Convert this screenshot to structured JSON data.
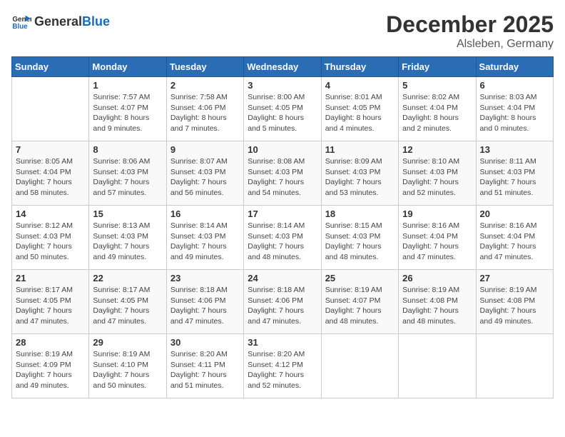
{
  "header": {
    "logo_general": "General",
    "logo_blue": "Blue",
    "month_year": "December 2025",
    "location": "Alsleben, Germany"
  },
  "weekdays": [
    "Sunday",
    "Monday",
    "Tuesday",
    "Wednesday",
    "Thursday",
    "Friday",
    "Saturday"
  ],
  "weeks": [
    [
      {
        "day": "",
        "info": ""
      },
      {
        "day": "1",
        "info": "Sunrise: 7:57 AM\nSunset: 4:07 PM\nDaylight: 8 hours\nand 9 minutes."
      },
      {
        "day": "2",
        "info": "Sunrise: 7:58 AM\nSunset: 4:06 PM\nDaylight: 8 hours\nand 7 minutes."
      },
      {
        "day": "3",
        "info": "Sunrise: 8:00 AM\nSunset: 4:05 PM\nDaylight: 8 hours\nand 5 minutes."
      },
      {
        "day": "4",
        "info": "Sunrise: 8:01 AM\nSunset: 4:05 PM\nDaylight: 8 hours\nand 4 minutes."
      },
      {
        "day": "5",
        "info": "Sunrise: 8:02 AM\nSunset: 4:04 PM\nDaylight: 8 hours\nand 2 minutes."
      },
      {
        "day": "6",
        "info": "Sunrise: 8:03 AM\nSunset: 4:04 PM\nDaylight: 8 hours\nand 0 minutes."
      }
    ],
    [
      {
        "day": "7",
        "info": "Sunrise: 8:05 AM\nSunset: 4:04 PM\nDaylight: 7 hours\nand 58 minutes."
      },
      {
        "day": "8",
        "info": "Sunrise: 8:06 AM\nSunset: 4:03 PM\nDaylight: 7 hours\nand 57 minutes."
      },
      {
        "day": "9",
        "info": "Sunrise: 8:07 AM\nSunset: 4:03 PM\nDaylight: 7 hours\nand 56 minutes."
      },
      {
        "day": "10",
        "info": "Sunrise: 8:08 AM\nSunset: 4:03 PM\nDaylight: 7 hours\nand 54 minutes."
      },
      {
        "day": "11",
        "info": "Sunrise: 8:09 AM\nSunset: 4:03 PM\nDaylight: 7 hours\nand 53 minutes."
      },
      {
        "day": "12",
        "info": "Sunrise: 8:10 AM\nSunset: 4:03 PM\nDaylight: 7 hours\nand 52 minutes."
      },
      {
        "day": "13",
        "info": "Sunrise: 8:11 AM\nSunset: 4:03 PM\nDaylight: 7 hours\nand 51 minutes."
      }
    ],
    [
      {
        "day": "14",
        "info": "Sunrise: 8:12 AM\nSunset: 4:03 PM\nDaylight: 7 hours\nand 50 minutes."
      },
      {
        "day": "15",
        "info": "Sunrise: 8:13 AM\nSunset: 4:03 PM\nDaylight: 7 hours\nand 49 minutes."
      },
      {
        "day": "16",
        "info": "Sunrise: 8:14 AM\nSunset: 4:03 PM\nDaylight: 7 hours\nand 49 minutes."
      },
      {
        "day": "17",
        "info": "Sunrise: 8:14 AM\nSunset: 4:03 PM\nDaylight: 7 hours\nand 48 minutes."
      },
      {
        "day": "18",
        "info": "Sunrise: 8:15 AM\nSunset: 4:03 PM\nDaylight: 7 hours\nand 48 minutes."
      },
      {
        "day": "19",
        "info": "Sunrise: 8:16 AM\nSunset: 4:04 PM\nDaylight: 7 hours\nand 47 minutes."
      },
      {
        "day": "20",
        "info": "Sunrise: 8:16 AM\nSunset: 4:04 PM\nDaylight: 7 hours\nand 47 minutes."
      }
    ],
    [
      {
        "day": "21",
        "info": "Sunrise: 8:17 AM\nSunset: 4:05 PM\nDaylight: 7 hours\nand 47 minutes."
      },
      {
        "day": "22",
        "info": "Sunrise: 8:17 AM\nSunset: 4:05 PM\nDaylight: 7 hours\nand 47 minutes."
      },
      {
        "day": "23",
        "info": "Sunrise: 8:18 AM\nSunset: 4:06 PM\nDaylight: 7 hours\nand 47 minutes."
      },
      {
        "day": "24",
        "info": "Sunrise: 8:18 AM\nSunset: 4:06 PM\nDaylight: 7 hours\nand 47 minutes."
      },
      {
        "day": "25",
        "info": "Sunrise: 8:19 AM\nSunset: 4:07 PM\nDaylight: 7 hours\nand 48 minutes."
      },
      {
        "day": "26",
        "info": "Sunrise: 8:19 AM\nSunset: 4:08 PM\nDaylight: 7 hours\nand 48 minutes."
      },
      {
        "day": "27",
        "info": "Sunrise: 8:19 AM\nSunset: 4:08 PM\nDaylight: 7 hours\nand 49 minutes."
      }
    ],
    [
      {
        "day": "28",
        "info": "Sunrise: 8:19 AM\nSunset: 4:09 PM\nDaylight: 7 hours\nand 49 minutes."
      },
      {
        "day": "29",
        "info": "Sunrise: 8:19 AM\nSunset: 4:10 PM\nDaylight: 7 hours\nand 50 minutes."
      },
      {
        "day": "30",
        "info": "Sunrise: 8:20 AM\nSunset: 4:11 PM\nDaylight: 7 hours\nand 51 minutes."
      },
      {
        "day": "31",
        "info": "Sunrise: 8:20 AM\nSunset: 4:12 PM\nDaylight: 7 hours\nand 52 minutes."
      },
      {
        "day": "",
        "info": ""
      },
      {
        "day": "",
        "info": ""
      },
      {
        "day": "",
        "info": ""
      }
    ]
  ]
}
